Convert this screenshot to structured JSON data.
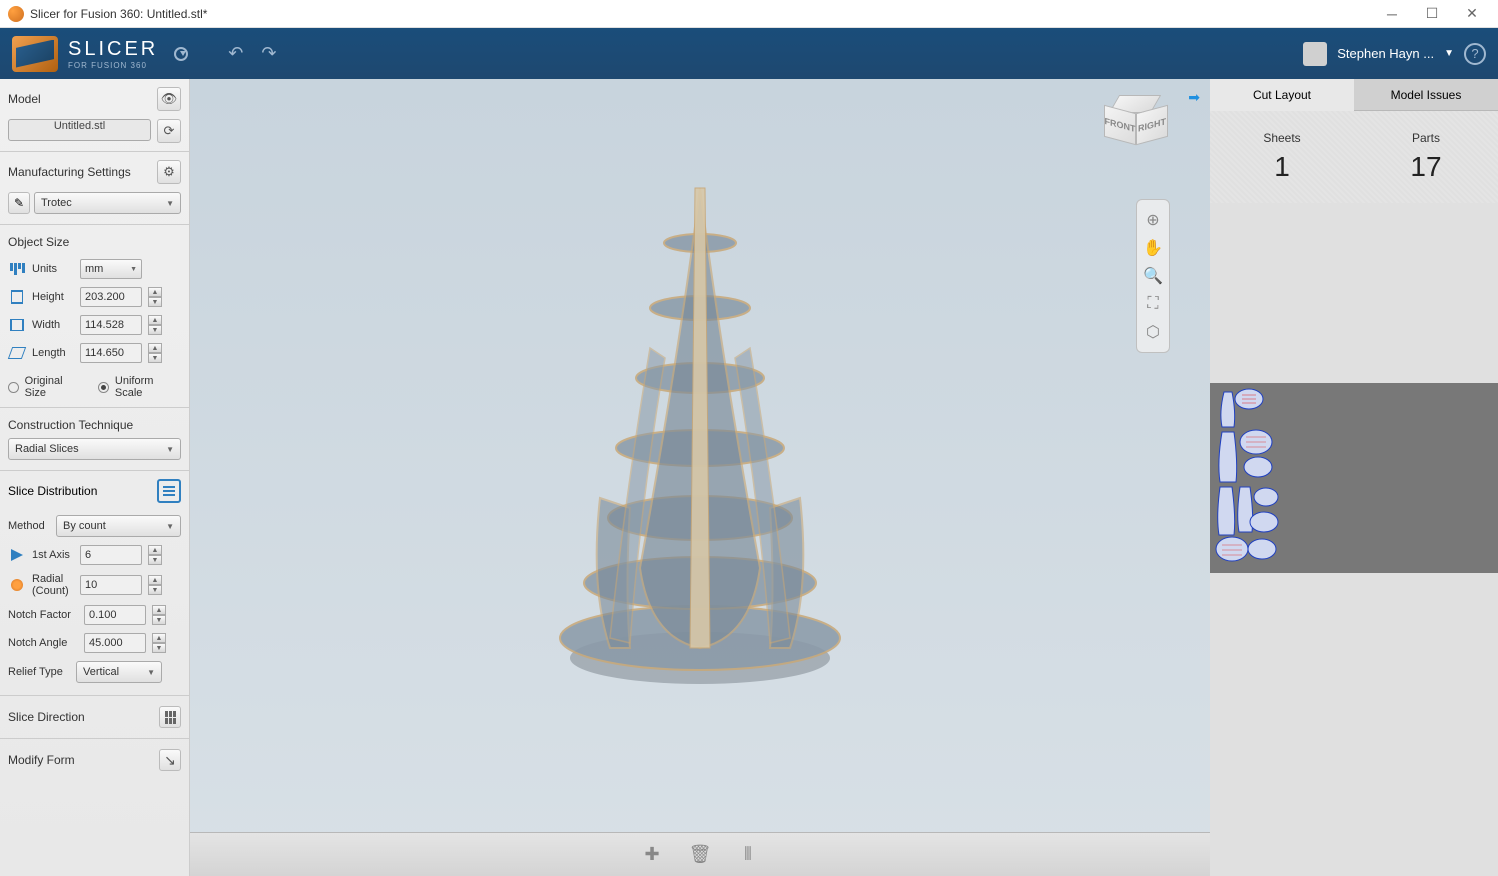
{
  "window": {
    "title": "Slicer for Fusion 360: Untitled.stl*"
  },
  "header": {
    "logo_main": "SLICER",
    "logo_sub": "FOR FUSION 360",
    "user_name": "Stephen Hayn ..."
  },
  "sidebar": {
    "model": {
      "label": "Model",
      "file": "Untitled.stl"
    },
    "manufacturing": {
      "label": "Manufacturing Settings",
      "value": "Trotec"
    },
    "object_size": {
      "label": "Object Size",
      "units_label": "Units",
      "units_value": "mm",
      "height_label": "Height",
      "height_value": "203.200",
      "width_label": "Width",
      "width_value": "114.528",
      "length_label": "Length",
      "length_value": "114.650",
      "radio_original": "Original Size",
      "radio_uniform": "Uniform Scale"
    },
    "construction": {
      "label": "Construction Technique",
      "value": "Radial Slices"
    },
    "slice_dist": {
      "label": "Slice Distribution",
      "method_label": "Method",
      "method_value": "By count",
      "axis1_label": "1st Axis",
      "axis1_value": "6",
      "radial_label": "Radial (Count)",
      "radial_value": "10",
      "notch_factor_label": "Notch Factor",
      "notch_factor_value": "0.100",
      "notch_angle_label": "Notch Angle",
      "notch_angle_value": "45.000",
      "relief_label": "Relief Type",
      "relief_value": "Vertical"
    },
    "slice_direction_label": "Slice Direction",
    "modify_form_label": "Modify Form"
  },
  "viewcube": {
    "front": "FRONT",
    "right": "RIGHT"
  },
  "right_panel": {
    "tab_cut": "Cut Layout",
    "tab_issues": "Model Issues",
    "sheets_label": "Sheets",
    "sheets_value": "1",
    "parts_label": "Parts",
    "parts_value": "17"
  }
}
